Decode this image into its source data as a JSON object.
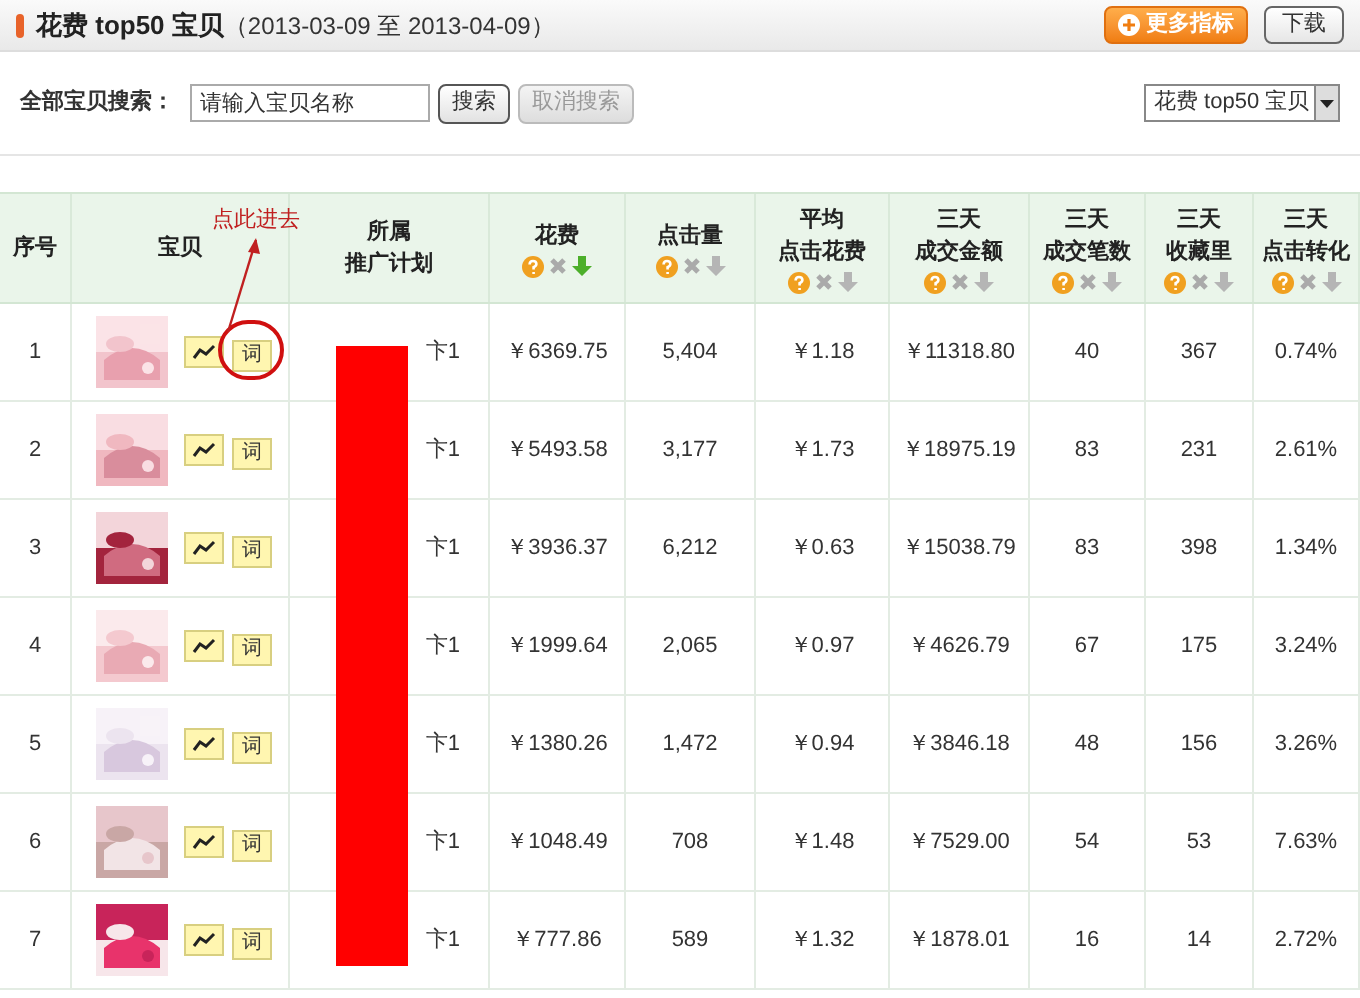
{
  "panel": {
    "title": "花费 top50 宝贝",
    "date_range": "（2013-03-09 至 2013-04-09）",
    "more_button": "更多指标",
    "download_button": "下载"
  },
  "search": {
    "label": "全部宝贝搜索：",
    "placeholder": "请输入宝贝名称",
    "search_button": "搜索",
    "cancel_button": "取消搜索",
    "cancel_disabled": true,
    "view_select": "花费 top50 宝贝"
  },
  "annotation": {
    "text": "点此进去"
  },
  "plan_redacted": true,
  "table": {
    "columns": [
      {
        "lines": [
          "序号"
        ]
      },
      {
        "lines": [
          "宝贝"
        ]
      },
      {
        "lines": [
          "所属",
          "推广计划"
        ]
      },
      {
        "lines": [
          "花费"
        ],
        "sorted": true
      },
      {
        "lines": [
          "点击量"
        ],
        "sorted": false
      },
      {
        "lines": [
          "平均",
          "点击花费"
        ],
        "sorted": false
      },
      {
        "lines": [
          "三天",
          "成交金额"
        ],
        "sorted": false
      },
      {
        "lines": [
          "三天",
          "成交笔数"
        ],
        "sorted": false
      },
      {
        "lines": [
          "三天",
          "收藏里"
        ],
        "sorted": false
      },
      {
        "lines": [
          "三天",
          "点击转化"
        ],
        "sorted": false
      }
    ],
    "rows": [
      {
        "circled": true,
        "cells": [
          "1",
          "词",
          "卞1",
          "￥6369.75",
          "5,404",
          "￥1.18",
          "￥11318.80",
          "40",
          "367",
          "0.74%"
        ]
      },
      {
        "circled": false,
        "cells": [
          "2",
          "词",
          "卞1",
          "￥5493.58",
          "3,177",
          "￥1.73",
          "￥18975.19",
          "83",
          "231",
          "2.61%"
        ]
      },
      {
        "circled": false,
        "cells": [
          "3",
          "词",
          "卞1",
          "￥3936.37",
          "6,212",
          "￥0.63",
          "￥15038.79",
          "83",
          "398",
          "1.34%"
        ]
      },
      {
        "circled": false,
        "cells": [
          "4",
          "词",
          "卞1",
          "￥1999.64",
          "2,065",
          "￥0.97",
          "￥4626.79",
          "67",
          "175",
          "3.24%"
        ]
      },
      {
        "circled": false,
        "cells": [
          "5",
          "词",
          "卞1",
          "￥1380.26",
          "1,472",
          "￥0.94",
          "￥3846.18",
          "48",
          "156",
          "3.26%"
        ]
      },
      {
        "circled": false,
        "cells": [
          "6",
          "词",
          "卞1",
          "￥1048.49",
          "708",
          "￥1.48",
          "￥7529.00",
          "54",
          "53",
          "7.63%"
        ]
      },
      {
        "circled": false,
        "cells": [
          "7",
          "词",
          "卞1",
          "￥777.86",
          "589",
          "￥1.32",
          "￥1878.01",
          "16",
          "14",
          "2.72%"
        ]
      }
    ]
  }
}
